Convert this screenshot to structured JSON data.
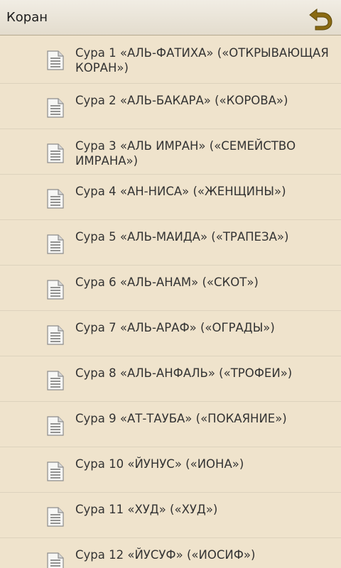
{
  "header": {
    "title": "Коран"
  },
  "surahs": [
    "Сура 1 «АЛЬ-ФАТИХА» («ОТКРЫВАЮЩАЯ КОРАН»)",
    "Сура 2 «АЛЬ-БАКАРА» («КОРОВА»)",
    "Сура 3 «АЛЬ ИМРАН» («СЕМЕЙСТВО ИМРАНА»)",
    "Сура 4 «АН-НИСА» («ЖЕНЩИНЫ»)",
    "Сура 5 «АЛЬ-МАИДА» («ТРАПЕЗА»)",
    "Сура 6 «АЛЬ-АНАМ» («СКОТ»)",
    "Сура 7 «АЛЬ-АРАФ» («ОГРАДЫ»)",
    "Сура 8 «АЛЬ-АНФАЛЬ» («ТРОФЕИ»)",
    "Сура 9 «АТ-ТАУБА» («ПОКАЯНИЕ»)",
    "Сура 10 «ЙУНУС» («ИОНА»)",
    "Сура 11 «ХУД» («ХУД»)",
    "Сура 12 «ЙУСУФ» («ИОСИФ»)"
  ],
  "icons": {
    "back": "back-arrow-icon",
    "item": "document-icon"
  },
  "colors": {
    "background": "#efe3cc",
    "header": "#e8e2d6",
    "back_arrow": "#8a6a12",
    "text": "#333333"
  }
}
